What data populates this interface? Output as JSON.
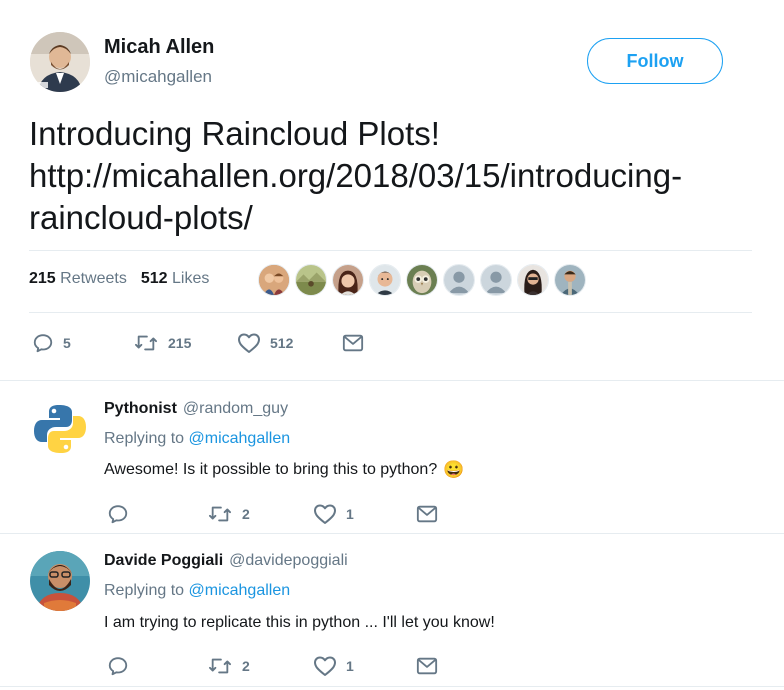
{
  "tweet": {
    "author_name": "Micah Allen",
    "author_handle": "@micahgallen",
    "follow_label": "Follow",
    "text_line1": "Introducing Raincloud Plots!",
    "link_text": "http://micahallen.org/2018/03/15/introducing-raincloud-plots/",
    "retweets_count": "215",
    "retweets_label": "Retweets",
    "likes_count": "512",
    "likes_label": "Likes",
    "actions": {
      "replies": "5",
      "retweets": "215",
      "likes": "512"
    },
    "likers": [
      {
        "icon": "avatar-couple",
        "color": "#c98a5a"
      },
      {
        "icon": "avatar-landscape",
        "color": "#8a9a5b"
      },
      {
        "icon": "avatar-woman",
        "color": "#7a4a3a"
      },
      {
        "icon": "avatar-man",
        "color": "#2f3a45"
      },
      {
        "icon": "avatar-owl",
        "color": "#6b7f52"
      },
      {
        "icon": "avatar-default",
        "color": "#aab8c2"
      },
      {
        "icon": "avatar-default",
        "color": "#aab8c2"
      },
      {
        "icon": "avatar-woman-dark",
        "color": "#3a3030"
      },
      {
        "icon": "avatar-man-outdoor",
        "color": "#5a7a8a"
      }
    ]
  },
  "replies": [
    {
      "name": "Pythonist",
      "handle": "@random_guy",
      "replying_label": "Replying to",
      "mention": "@micahgallen",
      "text": "Awesome! Is it possible to bring this to python?",
      "emoji": "😀",
      "actions": {
        "replies": "",
        "retweets": "2",
        "likes": "1"
      }
    },
    {
      "name": "Davide Poggiali",
      "handle": "@davidepoggiali",
      "replying_label": "Replying to",
      "mention": "@micahgallen",
      "text": "I am trying to replicate this in python ... I'll let you know!",
      "actions": {
        "replies": "",
        "retweets": "2",
        "likes": "1"
      }
    }
  ],
  "colors": {
    "accent": "#1da1f2",
    "muted": "#657786",
    "mention": "#1b95e0",
    "text": "#14171a",
    "border": "#e6ecf0"
  }
}
